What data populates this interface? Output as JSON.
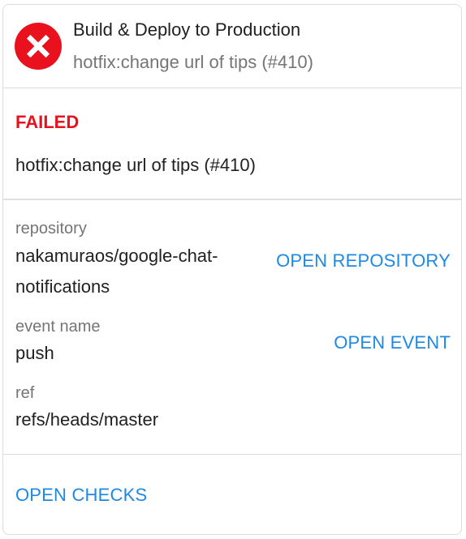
{
  "header": {
    "title": "Build & Deploy to Production",
    "subtitle": "hotfix:change url of tips (#410)",
    "icon": "error-circle-icon"
  },
  "status": {
    "label": "FAILED",
    "color": "#e8111d"
  },
  "commit": {
    "message": "hotfix:change url of tips (#410)"
  },
  "details": {
    "repository_label": "repository",
    "repository_line1": "nakamuraos/google-chat-",
    "repository_line2": "notifications",
    "open_repository": "OPEN REPOSITORY",
    "event_label": "event name",
    "event_value": "push",
    "open_event": "OPEN EVENT",
    "ref_label": "ref",
    "ref_value": "refs/heads/master"
  },
  "footer": {
    "open_checks": "OPEN CHECKS"
  },
  "colors": {
    "accent": "#1e88e5",
    "error": "#e8111d",
    "muted": "#757575"
  }
}
